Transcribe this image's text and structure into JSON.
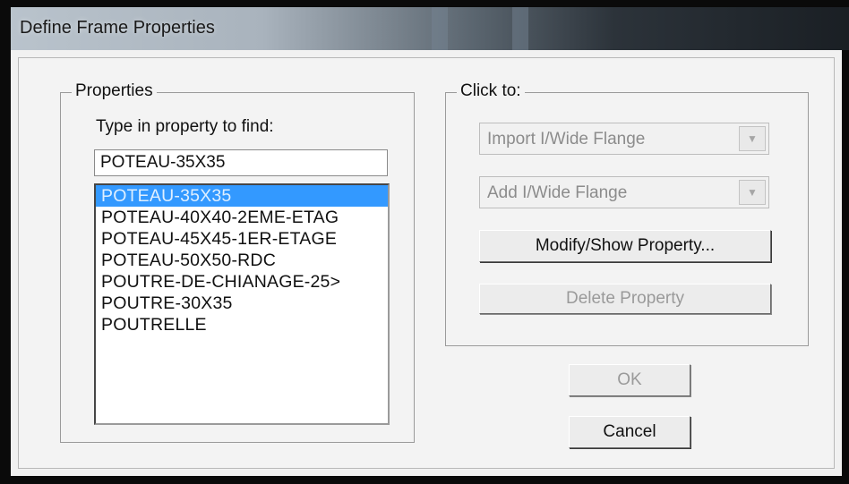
{
  "window": {
    "title": "Define Frame Properties"
  },
  "properties": {
    "caption": "Properties",
    "find_label": "Type in property to find:",
    "find_value": "POTEAU-35X35",
    "items": [
      "POTEAU-35X35",
      "POTEAU-40X40-2EME-ETAG",
      "POTEAU-45X45-1ER-ETAGE",
      "POTEAU-50X50-RDC",
      "POUTRE-DE-CHIANAGE-25>",
      "POUTRE-30X35",
      "POUTRELLE"
    ],
    "selected_index": 0
  },
  "click_to": {
    "caption": "Click to:",
    "import_combo": "Import I/Wide Flange",
    "add_combo": "Add I/Wide Flange",
    "modify_button": "Modify/Show Property...",
    "delete_button": "Delete Property"
  },
  "buttons": {
    "ok": "OK",
    "cancel": "Cancel"
  },
  "icons": {
    "combo_arrow": "chevron-down-icon"
  },
  "colors": {
    "selection": "#3399ff",
    "dialog_bg": "#f1f1f1"
  }
}
